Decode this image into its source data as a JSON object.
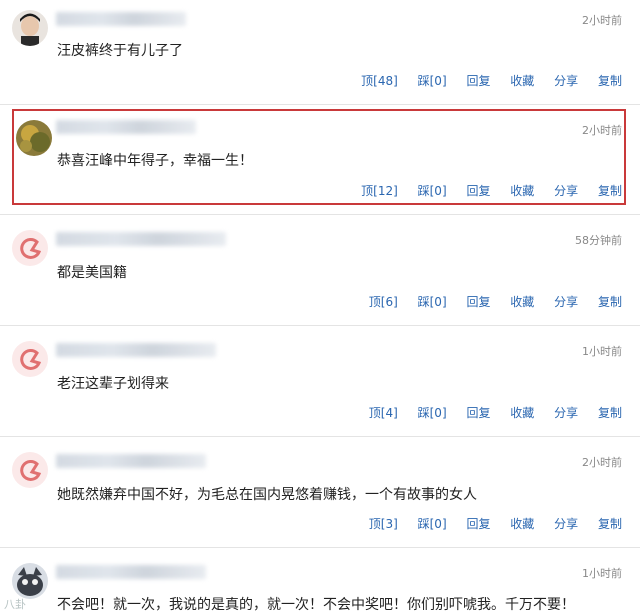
{
  "comments": [
    {
      "time": "2小时前",
      "text": "汪皮裤终于有儿子了",
      "actions": [
        "顶[48]",
        "踩[0]",
        "回复",
        "收藏",
        "分享",
        "复制"
      ]
    },
    {
      "time": "2小时前",
      "text": "恭喜汪峰中年得子，幸福一生！",
      "actions": [
        "顶[12]",
        "踩[0]",
        "回复",
        "收藏",
        "分享",
        "复制"
      ]
    },
    {
      "time": "58分钟前",
      "text": "都是美国籍",
      "actions": [
        "顶[6]",
        "踩[0]",
        "回复",
        "收藏",
        "分享",
        "复制"
      ]
    },
    {
      "time": "1小时前",
      "text": "老汪这辈子划得来",
      "actions": [
        "顶[4]",
        "踩[0]",
        "回复",
        "收藏",
        "分享",
        "复制"
      ]
    },
    {
      "time": "2小时前",
      "text": "她既然嫌弃中国不好，为毛总在国内晃悠着赚钱，一个有故事的女人",
      "actions": [
        "顶[3]",
        "踩[0]",
        "回复",
        "收藏",
        "分享",
        "复制"
      ]
    },
    {
      "time": "1小时前",
      "text": "不会吧！就一次，我说的是真的，就一次！不会中奖吧！你们别吓唬我。千万不要！"
    }
  ],
  "highlight_color": "#c9393a",
  "action_color": "#2a66b0",
  "watermark": "八卦"
}
